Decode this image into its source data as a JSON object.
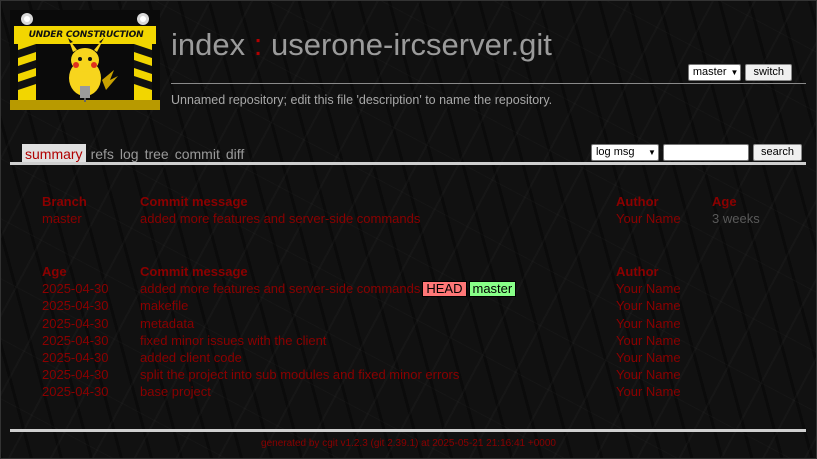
{
  "logo": {
    "text": "UNDER CONSTRUCTION",
    "icon": "under-construction-pikachu"
  },
  "header": {
    "title_part1": "index",
    "title_sep": ":",
    "title_repo": "userone-ircserver.git",
    "description": "Unnamed repository; edit this file 'description' to name the repository.",
    "branch_select": "master",
    "switch_label": "switch"
  },
  "tabs": [
    {
      "label": "summary",
      "active": true
    },
    {
      "label": "refs"
    },
    {
      "label": "log"
    },
    {
      "label": "tree"
    },
    {
      "label": "commit"
    },
    {
      "label": "diff"
    }
  ],
  "search": {
    "select_value": "log msg",
    "input_value": "",
    "button_label": "search"
  },
  "branches": {
    "headers": [
      "Branch",
      "Commit message",
      "Author",
      "Age"
    ],
    "rows": [
      {
        "branch": "master",
        "message": "added more features and server-side commands",
        "author": "Your Name",
        "age": "3 weeks"
      }
    ]
  },
  "log": {
    "headers": [
      "Age",
      "Commit message",
      "Author"
    ],
    "rows": [
      {
        "age": "2025-04-30",
        "message": "added more features and server-side commands",
        "author": "Your Name",
        "head": "HEAD",
        "branch": "master"
      },
      {
        "age": "2025-04-30",
        "message": "makefile",
        "author": "Your Name"
      },
      {
        "age": "2025-04-30",
        "message": "metadata",
        "author": "Your Name"
      },
      {
        "age": "2025-04-30",
        "message": "fixed minor issues with the client",
        "author": "Your Name"
      },
      {
        "age": "2025-04-30",
        "message": "added client code",
        "author": "Your Name"
      },
      {
        "age": "2025-04-30",
        "message": "split the project into sub modules and fixed minor errors",
        "author": "Your Name"
      },
      {
        "age": "2025-04-30",
        "message": "base project",
        "author": "Your Name"
      }
    ]
  },
  "footer": {
    "text": "generated by cgit v1.2.3 (git 2.39.1) at 2025-05-21 21:16:41 +0000"
  },
  "colors": {
    "link": "#8b0000",
    "muted": "#5a5a5a",
    "head_badge": "#ff7777",
    "branch_badge": "#88ff88"
  }
}
